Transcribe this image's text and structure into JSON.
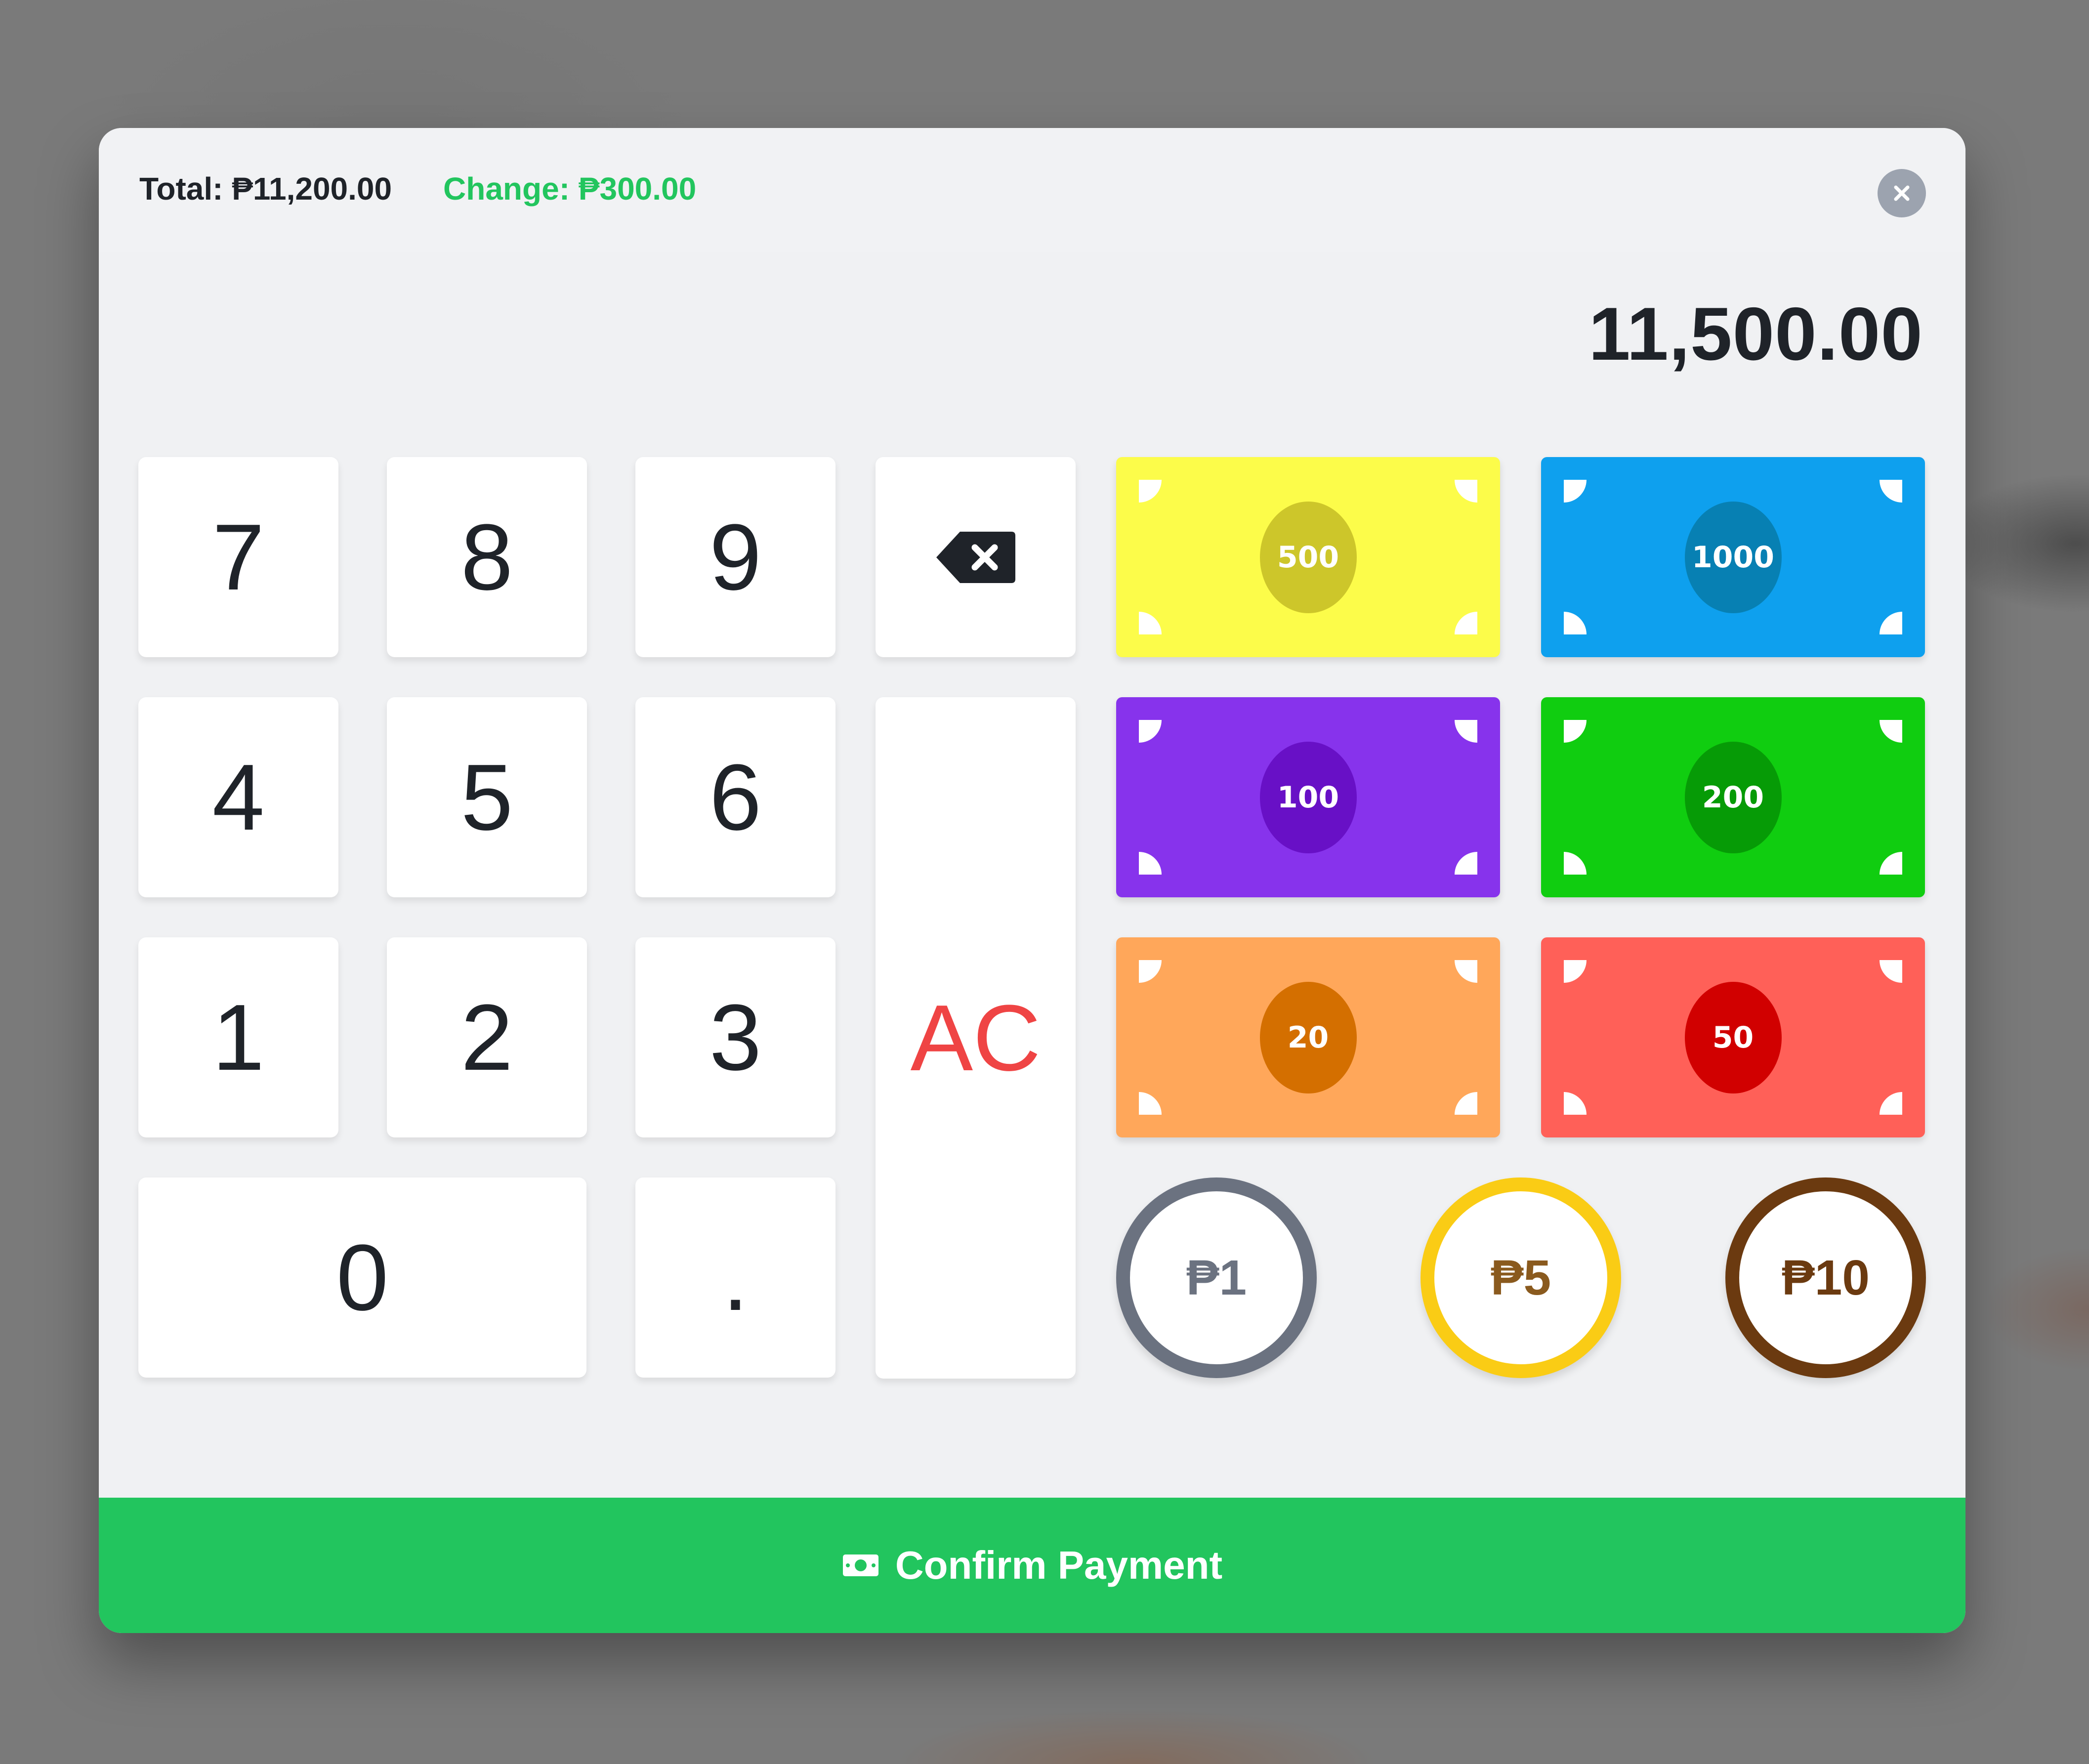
{
  "header": {
    "total_label": "Total: ₱11,200.00",
    "change_label": "Change: ₱300.00",
    "close_icon": "close-icon"
  },
  "display": {
    "amount": "11,500.00"
  },
  "keypad": {
    "k7": "7",
    "k8": "8",
    "k9": "9",
    "k4": "4",
    "k5": "5",
    "k6": "6",
    "k1": "1",
    "k2": "2",
    "k3": "3",
    "k0": "0",
    "kdot": ".",
    "clear": "AC",
    "backspace_icon": "backspace-icon"
  },
  "bills": [
    {
      "label": "500",
      "color": "#fcfc4a",
      "oval": "#cdc62a"
    },
    {
      "label": "1000",
      "color": "#0ea0ee",
      "oval": "#0780b3"
    },
    {
      "label": "100",
      "color": "#8733ec",
      "oval": "#6810c6"
    },
    {
      "label": "200",
      "color": "#10cd10",
      "oval": "#069b06"
    },
    {
      "label": "20",
      "color": "#ffa75a",
      "oval": "#d46f00"
    },
    {
      "label": "50",
      "color": "#ff6058",
      "oval": "#d10000"
    }
  ],
  "coins": [
    {
      "label": "₱1",
      "ring": "#6b7280",
      "text": "#6b7280"
    },
    {
      "label": "₱5",
      "ring": "#facc15",
      "text": "#8a5a1e"
    },
    {
      "label": "₱10",
      "ring": "#6b3a10",
      "text": "#6b3a10"
    }
  ],
  "footer": {
    "confirm_label": "Confirm Payment",
    "confirm_icon": "money-bill-icon"
  },
  "colors": {
    "accent": "#22c55e",
    "clear": "#ef4444"
  }
}
